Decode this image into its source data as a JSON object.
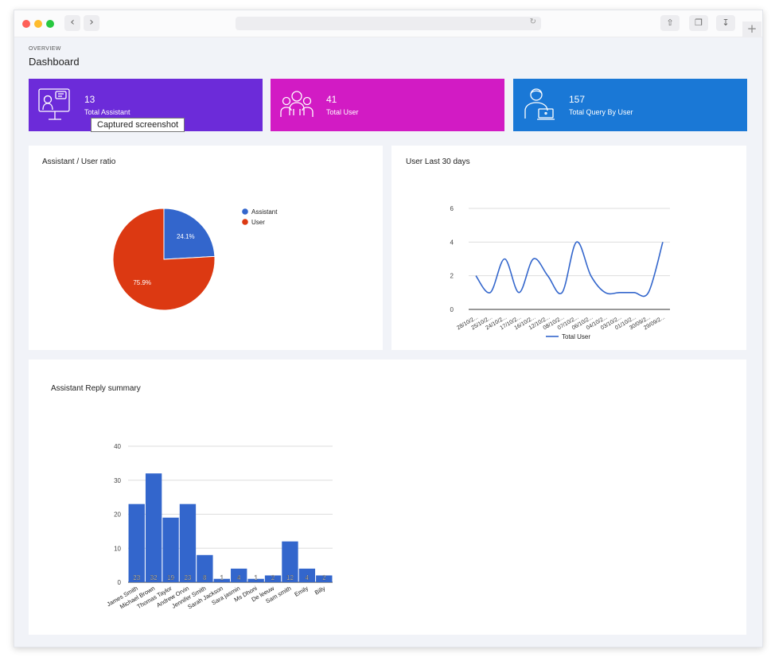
{
  "header": {
    "breadcrumb": "OVERVIEW",
    "title": "Dashboard"
  },
  "cards": [
    {
      "value": "13",
      "label": "Total Assistant",
      "color": "#6c2bd9",
      "icon": "assistant-icon"
    },
    {
      "value": "41",
      "label": "Total User",
      "color": "#d21bc4",
      "icon": "users-icon"
    },
    {
      "value": "157",
      "label": "Total Query By User",
      "color": "#1a78d6",
      "icon": "query-user-icon"
    }
  ],
  "tooltip": "Captured screenshot",
  "pie_panel": {
    "title": "Assistant / User ratio"
  },
  "line_panel": {
    "title": "User Last 30 days"
  },
  "bar_panel": {
    "title": "Assistant Reply summary"
  },
  "chart_data": [
    {
      "type": "pie",
      "categories": [
        "Assistant",
        "User"
      ],
      "values": [
        24.1,
        75.9
      ],
      "data_labels": [
        "24.1%",
        "75.9%"
      ],
      "colors": [
        "#3366cc",
        "#dc3912"
      ],
      "legend": "right"
    },
    {
      "type": "line",
      "x": [
        "28/10/2...",
        "25/10/2...",
        "24/10/2...",
        "17/10/2...",
        "16/10/2...",
        "12/10/2...",
        "08/10/2...",
        "07/10/2...",
        "06/10/2...",
        "04/10/2...",
        "03/10/2...",
        "01/10/2...",
        "30/09/2...",
        "29/09/2..."
      ],
      "series": [
        {
          "name": "Total User",
          "values": [
            2,
            1,
            3,
            1,
            3,
            2,
            1,
            4,
            2,
            1,
            1,
            1,
            1,
            4
          ]
        }
      ],
      "y_ticks": [
        "0",
        "2",
        "4",
        "6"
      ],
      "ylim": [
        0,
        6
      ],
      "grid": true,
      "legend": "bottom",
      "color": "#3366cc"
    },
    {
      "type": "bar",
      "categories": [
        "James Smith",
        "Michael Brown",
        "Thomas Taylor",
        "Andrew Orvin",
        "Jennifer Smith",
        "Sarah Jackson",
        "Sara jasmin",
        "Ms Dhoni",
        "De leeuw",
        "Sam smith",
        "Emily",
        "Billy"
      ],
      "values": [
        23,
        32,
        19,
        23,
        8,
        1,
        4,
        1,
        2,
        12,
        4,
        2
      ],
      "data_labels": [
        "23",
        "32",
        "19",
        "23",
        "8",
        "1",
        "4",
        "1",
        "2",
        "12",
        "4",
        "2"
      ],
      "y_ticks": [
        "0",
        "10",
        "20",
        "30",
        "40"
      ],
      "ylim": [
        0,
        40
      ],
      "grid": true,
      "color": "#3366cc"
    }
  ]
}
